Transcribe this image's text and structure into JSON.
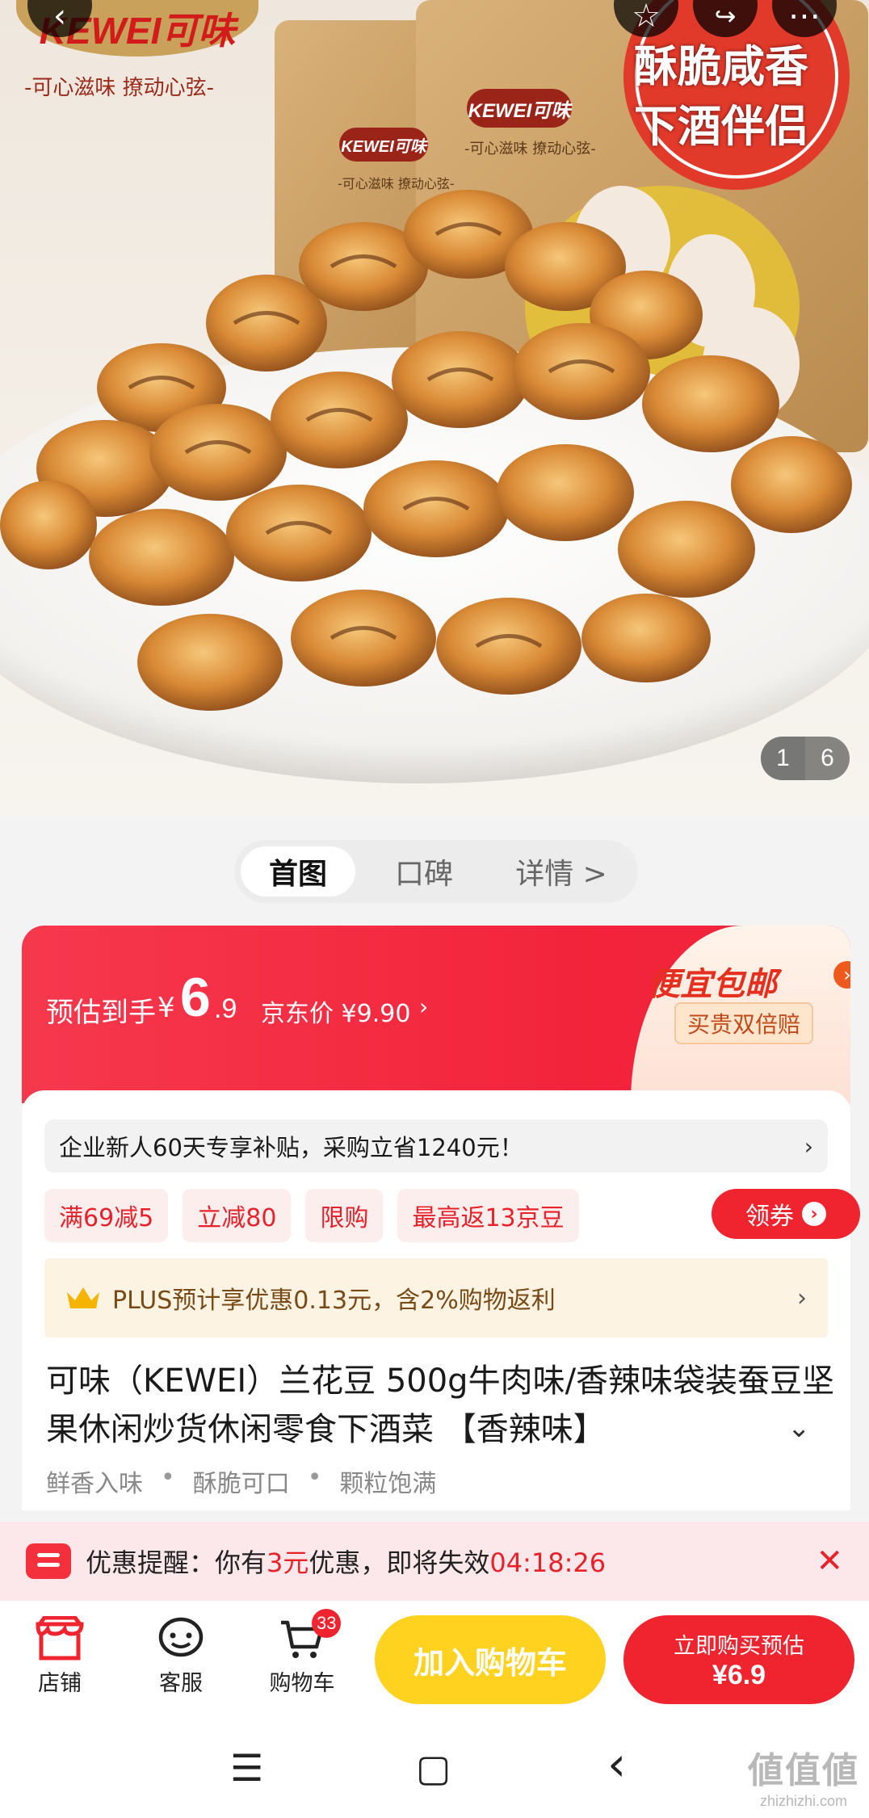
{
  "hero": {
    "brand_logo": "KEWEI可味",
    "brand_slogan": "-可心滋味 撩动心弦-",
    "bag_logo": "KEWEI可味",
    "bag_slogan": "-可心滋味 撩动心弦-",
    "sticker_line1": "酥脆咸香",
    "sticker_line2": "下酒伴侣",
    "counter_current": "1",
    "counter_total": "6",
    "icons": [
      "back-icon",
      "favorite-icon",
      "share-icon",
      "more-icon"
    ]
  },
  "tabs": [
    "首图",
    "口碑",
    "详情 >"
  ],
  "price": {
    "label": "预估到手",
    "symbol": "¥",
    "integer": "6",
    "decimal": ".9",
    "jd_price": "京东价 ¥9.90",
    "jd_chevron": "›",
    "free_shipping": "便宜包邮",
    "double_compensation": "买贵双倍赔"
  },
  "subsidy": {
    "text": "企业新人60天专享补贴，采购立省1240元！",
    "chevron": "›"
  },
  "promos": [
    "满69减5",
    "立减80",
    "限购",
    "最高返13京豆"
  ],
  "coupon": {
    "label": "领券",
    "icon": "›"
  },
  "plus": {
    "text": "PLUS预计享优惠0.13元，含2%购物返利",
    "chevron": "›"
  },
  "product": {
    "title": "可味（KEWEI）兰花豆 500g牛肉味/香辣味袋装蚕豆坚果休闲炒货休闲零食下酒菜 【香辣味】",
    "expand_icon": "⌄",
    "tags": [
      "鲜香入味",
      "酥脆可口",
      "颗粒饱满"
    ]
  },
  "reminder": {
    "prefix": "优惠提醒：你有",
    "amount": "3元",
    "middle": "优惠，即将失效",
    "countdown": "04:18:26",
    "close": "✕"
  },
  "actionbar": {
    "store": "店铺",
    "service": "客服",
    "cart": "购物车",
    "cart_count": "33",
    "add_to_cart": "加入购物车",
    "buy_now_line1": "立即购买预估",
    "buy_now_line2": "¥6.9"
  },
  "sysnav": {
    "menu": "☰",
    "home": "▢",
    "back": "‹"
  },
  "watermark": {
    "line1": "値值値",
    "line2": "zhizhizhi.com"
  },
  "colors": {
    "brand_red": "#f0242f",
    "cart_yellow": "#ffd21f",
    "plus_gold": "#7a4a16",
    "promo_bg": "#fdeeee"
  }
}
